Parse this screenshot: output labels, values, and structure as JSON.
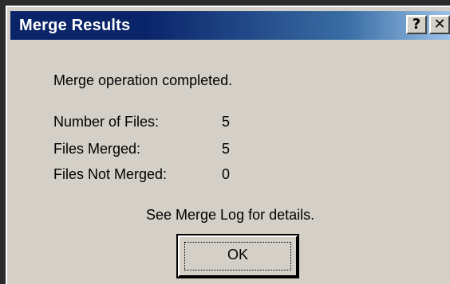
{
  "window": {
    "title": "Merge Results",
    "help_button": "?",
    "close_button": "X"
  },
  "message": "Merge operation completed.",
  "stats": [
    {
      "label": "Number of Files:",
      "value": "5"
    },
    {
      "label": "Files Merged:",
      "value": "5"
    },
    {
      "label": "Files Not Merged:",
      "value": "0"
    }
  ],
  "details_text": "See Merge Log for details.",
  "ok_button": "OK",
  "colors": {
    "titlebar_start": "#0a246a",
    "titlebar_end": "#a6caf0",
    "dialog_face": "#d4d0c8",
    "desktop": "#2b2b2b"
  }
}
